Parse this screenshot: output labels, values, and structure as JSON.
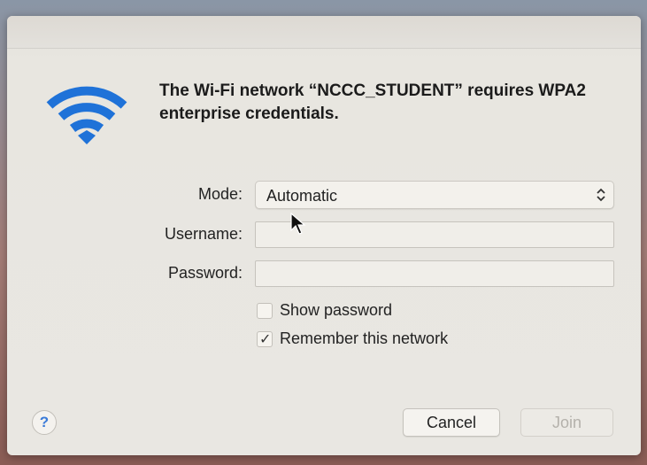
{
  "dialog": {
    "heading": "The Wi-Fi network “NCCC_STUDENT” requires WPA2 enterprise credentials.",
    "wifi_icon": "wifi-icon",
    "accent_color": "#1f72d8"
  },
  "form": {
    "mode_label": "Mode:",
    "mode_value": "Automatic",
    "username_label": "Username:",
    "username_value": "",
    "password_label": "Password:",
    "password_value": "",
    "show_password_label": "Show password",
    "show_password_checked": false,
    "remember_label": "Remember this network",
    "remember_checked": true
  },
  "footer": {
    "help_label": "?",
    "cancel_label": "Cancel",
    "join_label": "Join",
    "join_enabled": false
  }
}
